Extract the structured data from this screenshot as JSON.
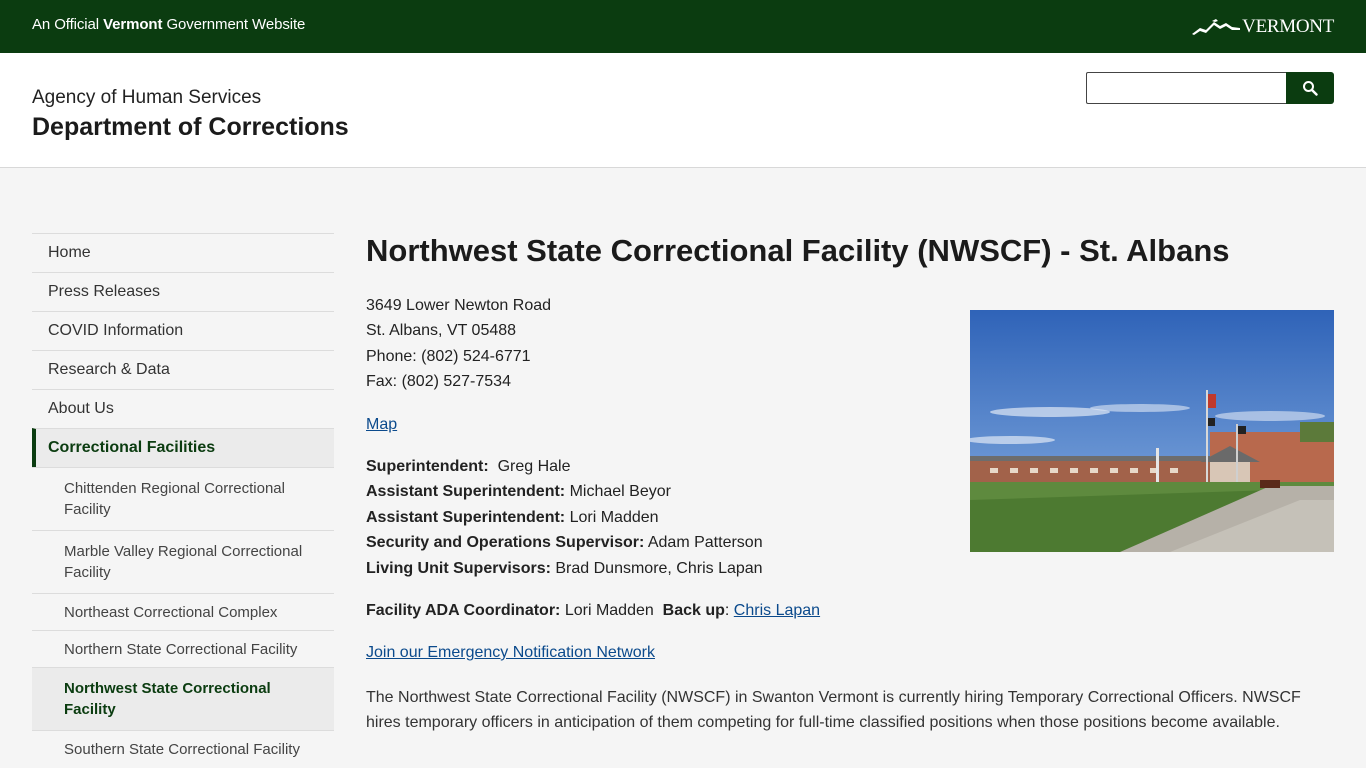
{
  "banner": {
    "prefix": "An Official ",
    "state": "Vermont",
    "suffix": " Government Website",
    "logo_text": "VERMONT"
  },
  "header": {
    "agency": "Agency of Human Services",
    "department": "Department of Corrections",
    "search": {
      "placeholder": "",
      "button_icon": "search-icon"
    }
  },
  "sidebar": {
    "top_items": [
      {
        "label": "Home"
      },
      {
        "label": "Press Releases"
      },
      {
        "label": "COVID Information"
      },
      {
        "label": "Research & Data"
      },
      {
        "label": "About Us"
      }
    ],
    "active_section": "Correctional Facilities",
    "sub_items": [
      {
        "label": "Chittenden Regional Correctional Facility"
      },
      {
        "label": "Marble Valley Regional Correctional Facility"
      },
      {
        "label": "Northeast Correctional Complex"
      },
      {
        "label": "Northern State Correctional Facility"
      },
      {
        "label": "Northwest State Correctional Facility"
      },
      {
        "label": "Southern State Correctional Facility"
      }
    ]
  },
  "main": {
    "title": "Northwest State Correctional Facility (NWSCF) - St. Albans",
    "address1": "3649 Lower Newton Road",
    "address2": "St. Albans, VT 05488",
    "phone": "Phone: (802) 524-6771",
    "fax": "Fax: (802) 527-7534",
    "map_link": "Map",
    "staff": [
      {
        "role": "Superintendent:",
        "name": "  Greg Hale"
      },
      {
        "role": "Assistant Superintendent:",
        "name": " Michael Beyor"
      },
      {
        "role": "Assistant Superintendent:",
        "name": " Lori Madden"
      },
      {
        "role": "Security and Operations Supervisor:",
        "name": " Adam Patterson"
      },
      {
        "role": "Living Unit Supervisors:",
        "name": " Brad Dunsmore, Chris Lapan"
      }
    ],
    "ada_label": "Facility ADA Coordinator:",
    "ada_name": " Lori Madden  ",
    "backup_label": "Back up",
    "backup_sep": ": ",
    "backup_name": "Chris Lapan",
    "emergency_link": "Join our Emergency Notification Network",
    "paragraph": "The Northwest State Correctional Facility (NWSCF) in Swanton Vermont is currently hiring Temporary Correctional Officers. NWSCF hires temporary officers in anticipation of them competing for full-time classified positions when those positions become available."
  },
  "colors": {
    "brand_green": "#0b3c10",
    "link_blue": "#0b4a8c",
    "page_bg": "#f5f5f5"
  }
}
